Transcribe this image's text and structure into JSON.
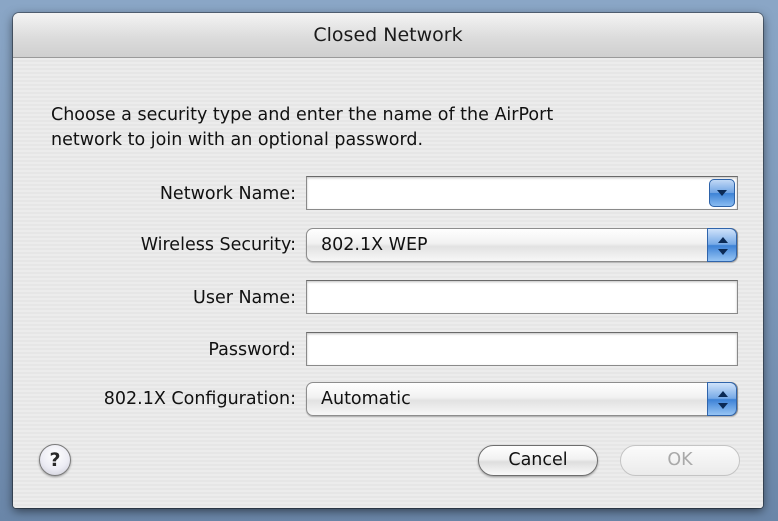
{
  "window": {
    "title": "Closed Network"
  },
  "dialog": {
    "intro_line1": "Choose a security type and enter the name of the AirPort",
    "intro_line2": "network to join with an optional password.",
    "fields": {
      "network_name": {
        "label": "Network Name:",
        "value": ""
      },
      "wireless_security": {
        "label": "Wireless Security:",
        "value": "802.1X WEP"
      },
      "user_name": {
        "label": "User Name:",
        "value": ""
      },
      "password": {
        "label": "Password:",
        "value": ""
      },
      "config_8021x": {
        "label": "802.1X Configuration:",
        "value": "Automatic"
      }
    },
    "buttons": {
      "help": "?",
      "cancel": "Cancel",
      "ok": "OK"
    }
  },
  "colors": {
    "accent_blue": "#3d82d6",
    "window_bg": "#ececec",
    "disabled_text": "#a9a9a9"
  },
  "icons": {
    "combo": "chevron-down-icon",
    "popup": "up-down-arrows-icon",
    "help": "question-mark-icon"
  }
}
